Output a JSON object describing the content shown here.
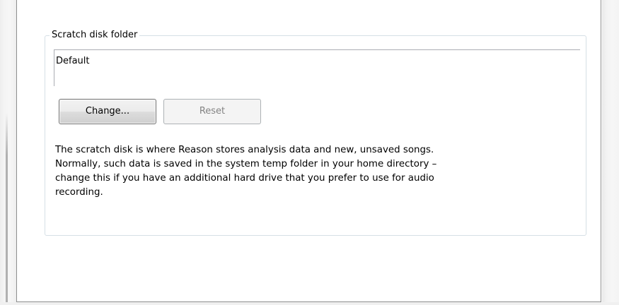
{
  "scratch_disk": {
    "group_title": "Scratch disk folder",
    "path_value": "Default",
    "change_button_label": "Change...",
    "reset_button_label": "Reset",
    "description_lines": [
      "The scratch disk is where Reason stores analysis data and new, unsaved songs.",
      "Normally, such data is saved in the system temp folder in your home directory –",
      "change this if you have an additional hard drive that you prefer to use for audio",
      "recording."
    ]
  },
  "colors": {
    "window_border": "#8e8f8f",
    "group_border": "#d5dfe5",
    "field_border": "#abadb3",
    "disabled_text": "#838383"
  }
}
